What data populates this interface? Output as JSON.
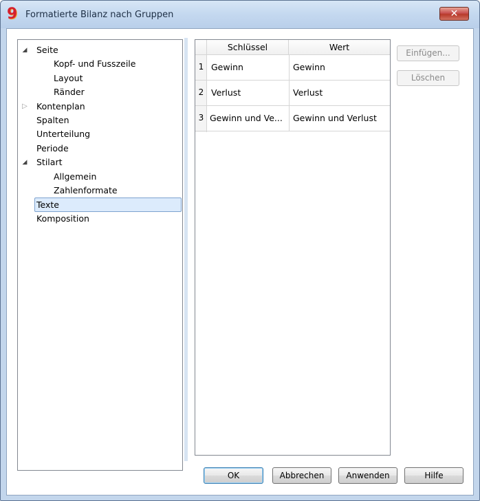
{
  "window": {
    "title": "Formatierte Bilanz nach Gruppen",
    "app_icon_glyph": "9",
    "close_glyph": "✕"
  },
  "tree": {
    "items": [
      {
        "label": "Seite",
        "expander": "◢",
        "indent": 0
      },
      {
        "label": "Kopf- und Fusszeile",
        "expander": "",
        "indent": 1
      },
      {
        "label": "Layout",
        "expander": "",
        "indent": 1
      },
      {
        "label": "Ränder",
        "expander": "",
        "indent": 1
      },
      {
        "label": "Kontenplan",
        "expander": "▷",
        "indent": 0
      },
      {
        "label": "Spalten",
        "expander": "",
        "indent": 0
      },
      {
        "label": "Unterteilung",
        "expander": "",
        "indent": 0
      },
      {
        "label": "Periode",
        "expander": "",
        "indent": 0
      },
      {
        "label": "Stilart",
        "expander": "◢",
        "indent": 0
      },
      {
        "label": "Allgemein",
        "expander": "",
        "indent": 1
      },
      {
        "label": "Zahlenformate",
        "expander": "",
        "indent": 1
      },
      {
        "label": "Texte",
        "expander": "",
        "indent": 0,
        "selected": true
      },
      {
        "label": "Komposition",
        "expander": "",
        "indent": 0
      }
    ]
  },
  "grid": {
    "columns": [
      "Schlüssel",
      "Wert"
    ],
    "rows": [
      {
        "num": "1",
        "key": "Gewinn",
        "value": "Gewinn"
      },
      {
        "num": "2",
        "key": "Verlust",
        "value": "Verlust"
      },
      {
        "num": "3",
        "key": "Gewinn und Ve...",
        "value": "Gewinn und Verlust"
      }
    ]
  },
  "side_buttons": {
    "insert": "Einfügen...",
    "delete": "Löschen"
  },
  "buttons": {
    "ok": "OK",
    "cancel": "Abbrechen",
    "apply": "Anwenden",
    "help": "Hilfe"
  },
  "colors": {
    "selection_bg": "#dcebfc",
    "selection_border": "#7da2ce",
    "close_red": "#c75050"
  }
}
